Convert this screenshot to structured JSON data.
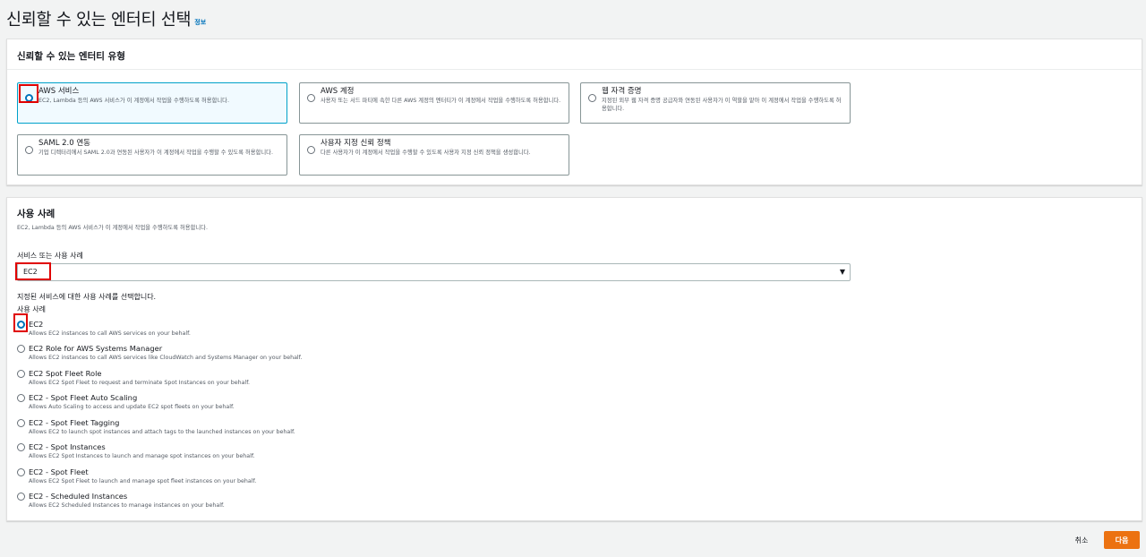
{
  "header": {
    "title": "신뢰할 수 있는 엔터티 선택",
    "info_link": "정보"
  },
  "entity_type": {
    "title": "신뢰할 수 있는 엔터티 유형",
    "options": [
      {
        "title": "AWS 서비스",
        "desc": "EC2, Lambda 등의 AWS 서비스가 이 계정에서 작업을 수행하도록 허용합니다.",
        "selected": true
      },
      {
        "title": "AWS 계정",
        "desc": "사용자 또는 서드 파티에 속한 다른 AWS 계정의 엔터티가 이 계정에서 작업을 수행하도록 허용합니다."
      },
      {
        "title": "웹 자격 증명",
        "desc": "지정된 외부 웹 자격 증명 공급자와 연동된 사용자가 이 역할을 맡아 이 계정에서 작업을 수행하도록 허용합니다."
      },
      {
        "title": "SAML 2.0 연동",
        "desc": "기업 디렉터리에서 SAML 2.0과 연동된 사용자가 이 계정에서 작업을 수행할 수 있도록 허용합니다."
      },
      {
        "title": "사용자 지정 신뢰 정책",
        "desc": "다른 사용자가 이 계정에서 작업을 수행할 수 있도록 사용자 지정 신뢰 정책을 생성합니다."
      }
    ]
  },
  "use_case": {
    "title": "사용 사례",
    "desc": "EC2, Lambda 등의 AWS 서비스가 이 계정에서 작업을 수행하도록 허용합니다.",
    "field_label": "서비스 또는 사용 사례",
    "select_value": "EC2",
    "hint": "지정된 서비스에 대한 사용 사례를 선택합니다.",
    "list_label": "사용 사례",
    "options": [
      {
        "title": "EC2",
        "desc": "Allows EC2 instances to call AWS services on your behalf.",
        "selected": true
      },
      {
        "title": "EC2 Role for AWS Systems Manager",
        "desc": "Allows EC2 instances to call AWS services like CloudWatch and Systems Manager on your behalf."
      },
      {
        "title": "EC2 Spot Fleet Role",
        "desc": "Allows EC2 Spot Fleet to request and terminate Spot Instances on your behalf."
      },
      {
        "title": "EC2 - Spot Fleet Auto Scaling",
        "desc": "Allows Auto Scaling to access and update EC2 spot fleets on your behalf."
      },
      {
        "title": "EC2 - Spot Fleet Tagging",
        "desc": "Allows EC2 to launch spot instances and attach tags to the launched instances on your behalf."
      },
      {
        "title": "EC2 - Spot Instances",
        "desc": "Allows EC2 Spot Instances to launch and manage spot instances on your behalf."
      },
      {
        "title": "EC2 - Spot Fleet",
        "desc": "Allows EC2 Spot Fleet to launch and manage spot fleet instances on your behalf."
      },
      {
        "title": "EC2 - Scheduled Instances",
        "desc": "Allows EC2 Scheduled Instances to manage instances on your behalf."
      }
    ]
  },
  "footer": {
    "cancel_label": "취소",
    "next_label": "다음"
  },
  "colors": {
    "primary": "#ec7211",
    "link": "#0073bb",
    "highlight": "#e00000",
    "selected_bg": "#f1faff"
  }
}
